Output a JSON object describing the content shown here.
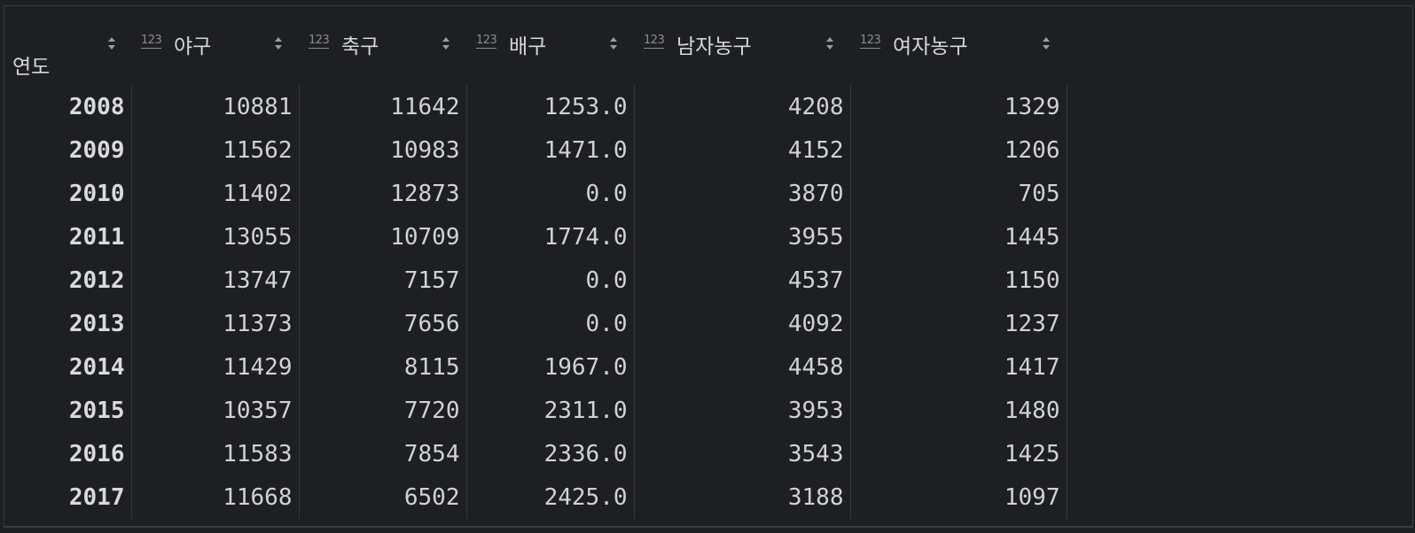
{
  "index_header": "연도",
  "type_label": "123",
  "columns": [
    {
      "name": "야구"
    },
    {
      "name": "축구"
    },
    {
      "name": "배구"
    },
    {
      "name": "남자농구"
    },
    {
      "name": "여자농구"
    }
  ],
  "rows": [
    {
      "year": "2008",
      "values": [
        "10881",
        "11642",
        "1253.0",
        "4208",
        "1329"
      ]
    },
    {
      "year": "2009",
      "values": [
        "11562",
        "10983",
        "1471.0",
        "4152",
        "1206"
      ]
    },
    {
      "year": "2010",
      "values": [
        "11402",
        "12873",
        "0.0",
        "3870",
        "705"
      ]
    },
    {
      "year": "2011",
      "values": [
        "13055",
        "10709",
        "1774.0",
        "3955",
        "1445"
      ]
    },
    {
      "year": "2012",
      "values": [
        "13747",
        "7157",
        "0.0",
        "4537",
        "1150"
      ]
    },
    {
      "year": "2013",
      "values": [
        "11373",
        "7656",
        "0.0",
        "4092",
        "1237"
      ]
    },
    {
      "year": "2014",
      "values": [
        "11429",
        "8115",
        "1967.0",
        "4458",
        "1417"
      ]
    },
    {
      "year": "2015",
      "values": [
        "10357",
        "7720",
        "2311.0",
        "3953",
        "1480"
      ]
    },
    {
      "year": "2016",
      "values": [
        "11583",
        "7854",
        "2336.0",
        "3543",
        "1425"
      ]
    },
    {
      "year": "2017",
      "values": [
        "11668",
        "6502",
        "2425.0",
        "3188",
        "1097"
      ]
    }
  ]
}
